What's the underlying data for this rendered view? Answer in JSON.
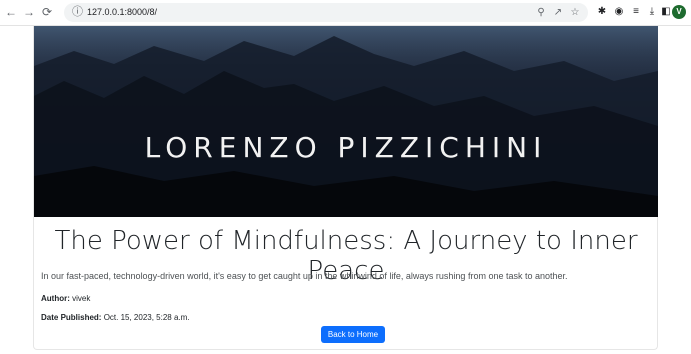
{
  "browser": {
    "url": "127.0.0.1:8000/8/",
    "profile_initial": "V",
    "icons": [
      "back-icon",
      "forward-icon",
      "reload-icon",
      "info-icon",
      "zoom-icon",
      "share-icon",
      "star-icon",
      "extensions-icon",
      "media-icon",
      "reading-list-icon",
      "download-icon",
      "sidebar-icon"
    ]
  },
  "post": {
    "hero_text": "LORENZO PIZZICHINI",
    "title": "The Power of Mindfulness: A Journey to Inner Peace",
    "excerpt": "In our fast-paced, technology-driven world, it's easy to get caught up in the whirlwind of life, always rushing from one task to another.",
    "author_label": "Author:",
    "author": "vivek",
    "date_label": "Date Published:",
    "date": "Oct. 15, 2023, 5:28 a.m.",
    "back_button": "Back to Home"
  },
  "colors": {
    "button": "#0d6efd",
    "profile": "#1e6b2f"
  }
}
